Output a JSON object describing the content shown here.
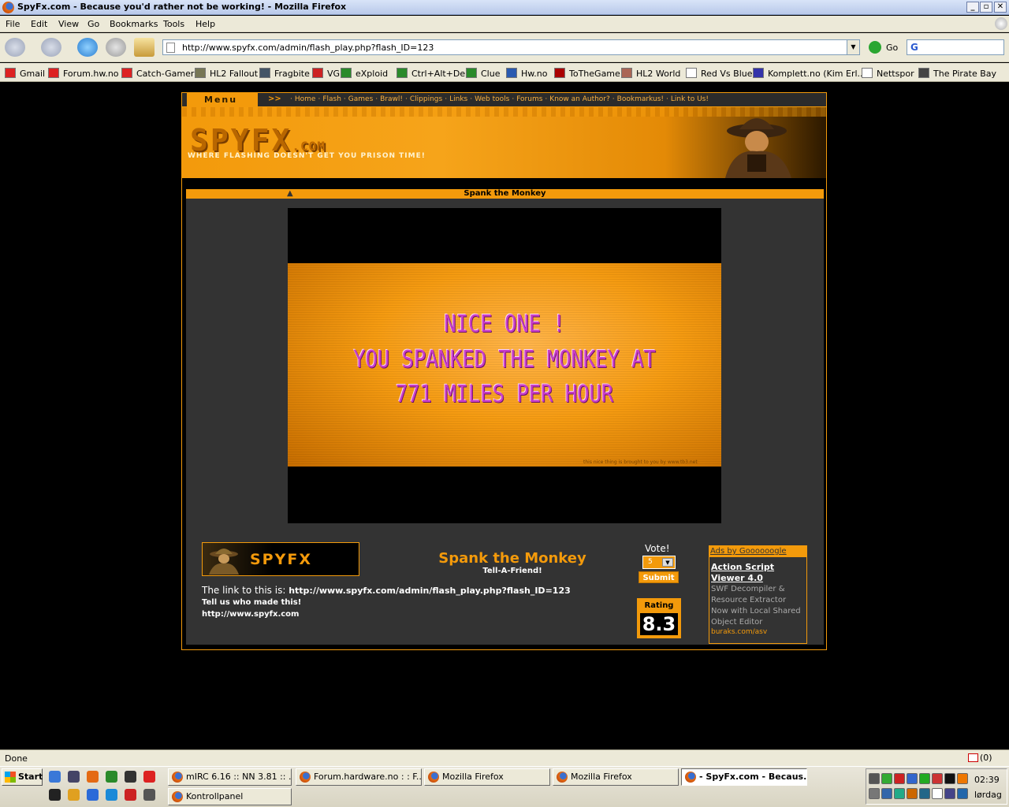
{
  "window": {
    "title": "SpyFx.com - Because you'd rather not be working! - Mozilla Firefox",
    "buttons": {
      "minimize": "_",
      "maximize": "▫",
      "close": "✕"
    }
  },
  "menu": [
    "File",
    "Edit",
    "View",
    "Go",
    "Bookmarks",
    "Tools",
    "Help"
  ],
  "nav": {
    "url": "http://www.spyfx.com/admin/flash_play.php?flash_ID=123",
    "go_label": "Go",
    "search_placeholder": ""
  },
  "bookmarks": [
    {
      "label": "Gmail",
      "icon": "gmail-icon"
    },
    {
      "label": "Forum.hw.no",
      "icon": "gmail-icon"
    },
    {
      "label": "Catch-Gamer",
      "icon": "gmail-icon"
    },
    {
      "label": "HL2 Fallout",
      "icon": "hl2-icon"
    },
    {
      "label": "Fragbite",
      "icon": "fragbite-icon"
    },
    {
      "label": "VG",
      "icon": "vg-icon"
    },
    {
      "label": "eXploid",
      "icon": "exploid-icon"
    },
    {
      "label": "Ctrl+Alt+Del",
      "icon": "exploid-icon"
    },
    {
      "label": "Clue",
      "icon": "exploid-icon"
    },
    {
      "label": "Hw.no",
      "icon": "hw-icon"
    },
    {
      "label": "ToTheGame",
      "icon": "tothegame-icon"
    },
    {
      "label": "HL2 World",
      "icon": "hl2world-icon"
    },
    {
      "label": "Red Vs Blue",
      "icon": "page-icon"
    },
    {
      "label": "Komplett.no (Kim Erl...",
      "icon": "komplett-icon"
    },
    {
      "label": "Nettspor",
      "icon": "page-icon"
    },
    {
      "label": "The Pirate Bay",
      "icon": "pirate-icon"
    }
  ],
  "site": {
    "menu_label": "Menu",
    "menu_arrow": ">>",
    "links": [
      "Home",
      "Flash",
      "Games",
      "Brawl!",
      "Clippings",
      "Links",
      "Web tools",
      "Forums",
      "Know an Author?",
      "Bookmarkus!",
      "Link to Us!"
    ],
    "logo_text": "SPYFX",
    "logo_suffix": ".COM",
    "tagline": "WHERE FLASHING DOESN'T GET YOU PRISON TIME!"
  },
  "flash": {
    "title": "Spank the Monkey",
    "screen_lines": [
      "NICE ONE !",
      "YOU SPANKED THE MONKEY AT",
      "771 MILES PER HOUR"
    ],
    "credit": "this nice thing is brought to you by www.tb3.net"
  },
  "info": {
    "promo_text": "SPYFX",
    "name": "Spank the Monkey",
    "tell_a_friend": "Tell-A-Friend!",
    "link_label": "The link to this is:",
    "link_url": "http://www.spyfx.com/admin/flash_play.php?flash_ID=123",
    "tell_us": "Tell us who made this!",
    "site_url": "http://www.spyfx.com"
  },
  "vote": {
    "label": "Vote!",
    "selected": "5",
    "submit": "Submit",
    "rating_label": "Rating",
    "rating": "8.3"
  },
  "ad": {
    "header": "Ads by Goooooogle",
    "title": "Action Script Viewer 4.0",
    "desc": "SWF Decompiler & Resource Extractor Now with Local Shared Object Editor",
    "url": "buraks.com/asv"
  },
  "status": {
    "text": "Done",
    "gmail": "(0)"
  },
  "taskbar": {
    "start": "Start",
    "tasks": [
      {
        "label": "mIRC 6.16 :: NN 3.81 :: ...",
        "active": false
      },
      {
        "label": "Forum.hardware.no : : F...",
        "active": false
      },
      {
        "label": "Mozilla Firefox",
        "active": false
      },
      {
        "label": "Mozilla Firefox",
        "active": false
      },
      {
        "label": "- SpyFx.com - Becaus...",
        "active": true
      },
      {
        "label": "Kontrollpanel",
        "active": false
      }
    ],
    "clock": "02:39",
    "day": "lørdag"
  },
  "colors": {
    "accent": "#f39a0b",
    "flash_text": "#c83ec8",
    "content_bg": "#333333"
  }
}
